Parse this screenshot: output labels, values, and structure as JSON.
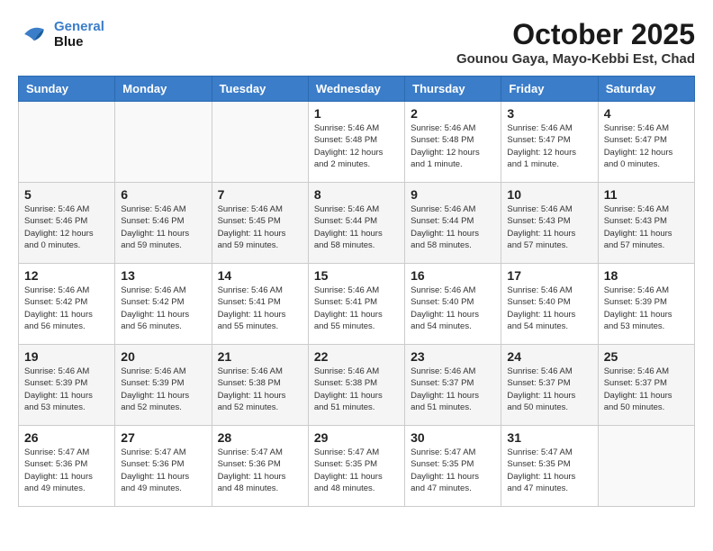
{
  "header": {
    "logo_line1": "General",
    "logo_line2": "Blue",
    "month": "October 2025",
    "location": "Gounou Gaya, Mayo-Kebbi Est, Chad"
  },
  "days_of_week": [
    "Sunday",
    "Monday",
    "Tuesday",
    "Wednesday",
    "Thursday",
    "Friday",
    "Saturday"
  ],
  "weeks": [
    [
      {
        "day": "",
        "info": ""
      },
      {
        "day": "",
        "info": ""
      },
      {
        "day": "",
        "info": ""
      },
      {
        "day": "1",
        "info": "Sunrise: 5:46 AM\nSunset: 5:48 PM\nDaylight: 12 hours and 2 minutes."
      },
      {
        "day": "2",
        "info": "Sunrise: 5:46 AM\nSunset: 5:48 PM\nDaylight: 12 hours and 1 minute."
      },
      {
        "day": "3",
        "info": "Sunrise: 5:46 AM\nSunset: 5:47 PM\nDaylight: 12 hours and 1 minute."
      },
      {
        "day": "4",
        "info": "Sunrise: 5:46 AM\nSunset: 5:47 PM\nDaylight: 12 hours and 0 minutes."
      }
    ],
    [
      {
        "day": "5",
        "info": "Sunrise: 5:46 AM\nSunset: 5:46 PM\nDaylight: 12 hours and 0 minutes."
      },
      {
        "day": "6",
        "info": "Sunrise: 5:46 AM\nSunset: 5:46 PM\nDaylight: 11 hours and 59 minutes."
      },
      {
        "day": "7",
        "info": "Sunrise: 5:46 AM\nSunset: 5:45 PM\nDaylight: 11 hours and 59 minutes."
      },
      {
        "day": "8",
        "info": "Sunrise: 5:46 AM\nSunset: 5:44 PM\nDaylight: 11 hours and 58 minutes."
      },
      {
        "day": "9",
        "info": "Sunrise: 5:46 AM\nSunset: 5:44 PM\nDaylight: 11 hours and 58 minutes."
      },
      {
        "day": "10",
        "info": "Sunrise: 5:46 AM\nSunset: 5:43 PM\nDaylight: 11 hours and 57 minutes."
      },
      {
        "day": "11",
        "info": "Sunrise: 5:46 AM\nSunset: 5:43 PM\nDaylight: 11 hours and 57 minutes."
      }
    ],
    [
      {
        "day": "12",
        "info": "Sunrise: 5:46 AM\nSunset: 5:42 PM\nDaylight: 11 hours and 56 minutes."
      },
      {
        "day": "13",
        "info": "Sunrise: 5:46 AM\nSunset: 5:42 PM\nDaylight: 11 hours and 56 minutes."
      },
      {
        "day": "14",
        "info": "Sunrise: 5:46 AM\nSunset: 5:41 PM\nDaylight: 11 hours and 55 minutes."
      },
      {
        "day": "15",
        "info": "Sunrise: 5:46 AM\nSunset: 5:41 PM\nDaylight: 11 hours and 55 minutes."
      },
      {
        "day": "16",
        "info": "Sunrise: 5:46 AM\nSunset: 5:40 PM\nDaylight: 11 hours and 54 minutes."
      },
      {
        "day": "17",
        "info": "Sunrise: 5:46 AM\nSunset: 5:40 PM\nDaylight: 11 hours and 54 minutes."
      },
      {
        "day": "18",
        "info": "Sunrise: 5:46 AM\nSunset: 5:39 PM\nDaylight: 11 hours and 53 minutes."
      }
    ],
    [
      {
        "day": "19",
        "info": "Sunrise: 5:46 AM\nSunset: 5:39 PM\nDaylight: 11 hours and 53 minutes."
      },
      {
        "day": "20",
        "info": "Sunrise: 5:46 AM\nSunset: 5:39 PM\nDaylight: 11 hours and 52 minutes."
      },
      {
        "day": "21",
        "info": "Sunrise: 5:46 AM\nSunset: 5:38 PM\nDaylight: 11 hours and 52 minutes."
      },
      {
        "day": "22",
        "info": "Sunrise: 5:46 AM\nSunset: 5:38 PM\nDaylight: 11 hours and 51 minutes."
      },
      {
        "day": "23",
        "info": "Sunrise: 5:46 AM\nSunset: 5:37 PM\nDaylight: 11 hours and 51 minutes."
      },
      {
        "day": "24",
        "info": "Sunrise: 5:46 AM\nSunset: 5:37 PM\nDaylight: 11 hours and 50 minutes."
      },
      {
        "day": "25",
        "info": "Sunrise: 5:46 AM\nSunset: 5:37 PM\nDaylight: 11 hours and 50 minutes."
      }
    ],
    [
      {
        "day": "26",
        "info": "Sunrise: 5:47 AM\nSunset: 5:36 PM\nDaylight: 11 hours and 49 minutes."
      },
      {
        "day": "27",
        "info": "Sunrise: 5:47 AM\nSunset: 5:36 PM\nDaylight: 11 hours and 49 minutes."
      },
      {
        "day": "28",
        "info": "Sunrise: 5:47 AM\nSunset: 5:36 PM\nDaylight: 11 hours and 48 minutes."
      },
      {
        "day": "29",
        "info": "Sunrise: 5:47 AM\nSunset: 5:35 PM\nDaylight: 11 hours and 48 minutes."
      },
      {
        "day": "30",
        "info": "Sunrise: 5:47 AM\nSunset: 5:35 PM\nDaylight: 11 hours and 47 minutes."
      },
      {
        "day": "31",
        "info": "Sunrise: 5:47 AM\nSunset: 5:35 PM\nDaylight: 11 hours and 47 minutes."
      },
      {
        "day": "",
        "info": ""
      }
    ]
  ]
}
